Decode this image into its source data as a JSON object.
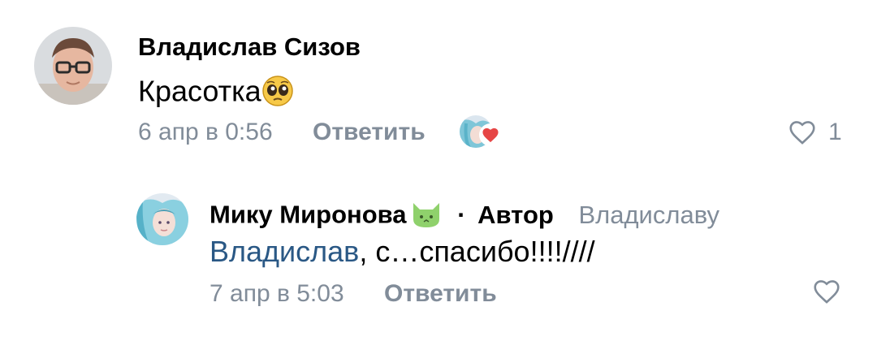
{
  "comment": {
    "author": "Владислав Сизов",
    "text": "Красотка",
    "text_emoji": "pleading-face-emoji",
    "date": "6 апр в 0:56",
    "reply_label": "Ответить",
    "like_count": "1"
  },
  "reply": {
    "author": "Мику Миронова",
    "author_emoji": "green-cat-emoji",
    "separator": "·",
    "author_badge": "Автор",
    "reply_to": "Владиславу",
    "mention": "Владислав",
    "text": ", с…спасибо!!!!////",
    "date": "7 апр в 5:03",
    "reply_label": "Ответить"
  },
  "colors": {
    "meta": "#818c99",
    "mention": "#2a5885",
    "heart_red": "#e64646"
  }
}
